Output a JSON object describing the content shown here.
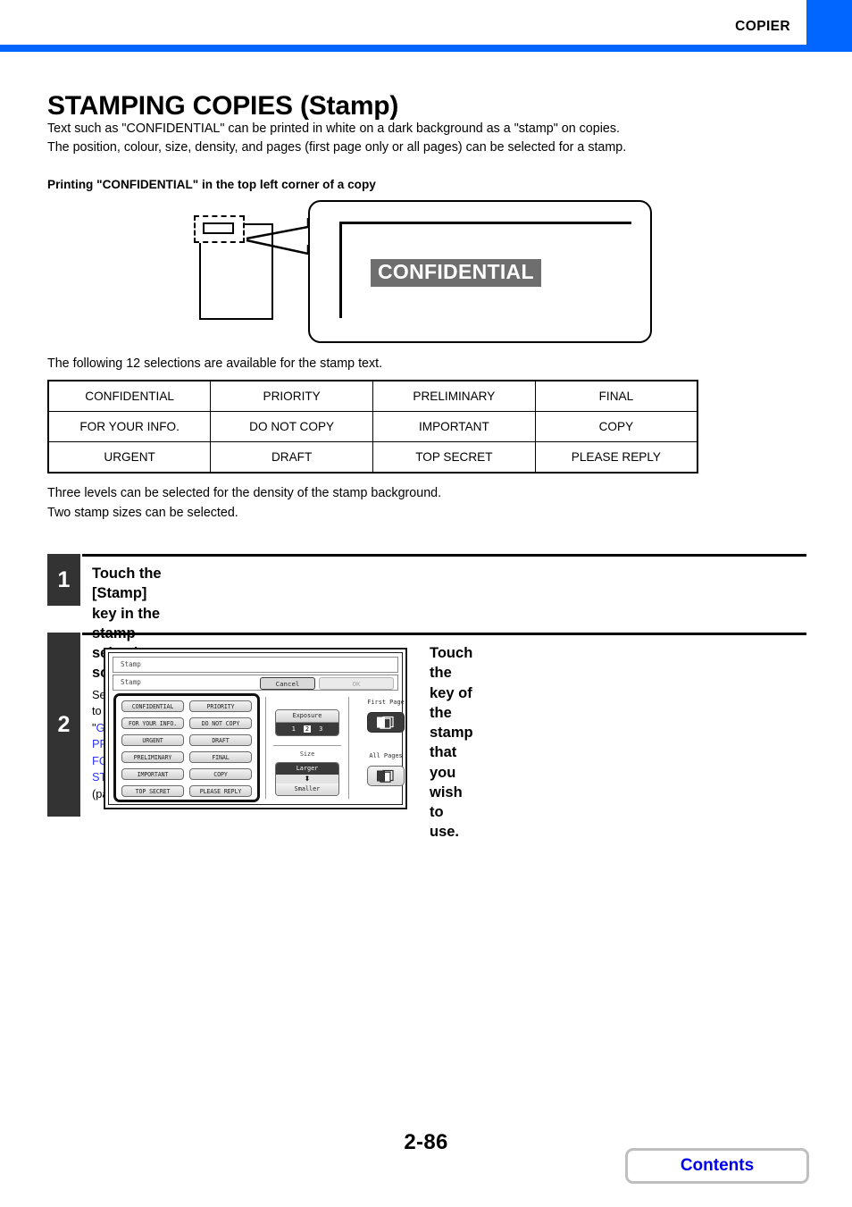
{
  "header": {
    "section_label": "COPIER",
    "accent_color": "#0066ff"
  },
  "page_title": "STAMPING COPIES (Stamp)",
  "intro": {
    "line1": "Text such as \"CONFIDENTIAL\" can be printed in white on a dark background as a \"stamp\" on copies.",
    "line2": "The position, colour, size, density, and pages (first page only or all pages) can be selected for a stamp."
  },
  "subheading": "Printing \"CONFIDENTIAL\" in the top left corner of a copy",
  "figure": {
    "stamp_text": "CONFIDENTIAL",
    "stamp_bg_color": "#6e6e6e",
    "stamp_text_color": "#ffffff"
  },
  "selection_note": "The following 12 selections are available for the stamp text.",
  "stamp_table": {
    "rows": [
      [
        "CONFIDENTIAL",
        "PRIORITY",
        "PRELIMINARY",
        "FINAL"
      ],
      [
        "FOR YOUR INFO.",
        "DO NOT COPY",
        "IMPORTANT",
        "COPY"
      ],
      [
        "URGENT",
        "DRAFT",
        "TOP SECRET",
        "PLEASE REPLY"
      ]
    ]
  },
  "levels_note": {
    "line1": "Three levels can be selected for the density of the stamp background.",
    "line2": "Two stamp sizes can be selected."
  },
  "steps": [
    {
      "number": "1",
      "heading": "Touch the [Stamp] key in the stamp selection screen.",
      "sub_prefix": "See steps 1 to 4 of \"",
      "sub_link": "GENERAL PROCEDURE FOR USING STAMP",
      "sub_suffix": "\" (page 2-81)."
    },
    {
      "number": "2",
      "heading_line1": "Touch the key of the stamp that you",
      "heading_line2": "wish to use."
    }
  ],
  "lcd": {
    "title_bar": "Stamp",
    "screen_label": "Stamp",
    "cancel_label": "Cancel",
    "ok_label": "OK",
    "stamp_keys": [
      "CONFIDENTIAL",
      "PRIORITY",
      "FOR YOUR INFO.",
      "DO NOT COPY",
      "URGENT",
      "DRAFT",
      "PRELIMINARY",
      "FINAL",
      "IMPORTANT",
      "COPY",
      "TOP SECRET",
      "PLEASE REPLY"
    ],
    "exposure": {
      "label": "Exposure",
      "values": [
        "1",
        "2",
        "3"
      ],
      "selected": "2"
    },
    "size": {
      "label": "Size",
      "larger_label": "Larger",
      "smaller_label": "Smaller",
      "arrows": "⬍",
      "selected": "Larger"
    },
    "pages": {
      "first_page_label": "First Page",
      "all_pages_label": "All Pages",
      "selected": "First Page"
    }
  },
  "footer": {
    "page_number": "2-86",
    "contents_label": "Contents"
  }
}
